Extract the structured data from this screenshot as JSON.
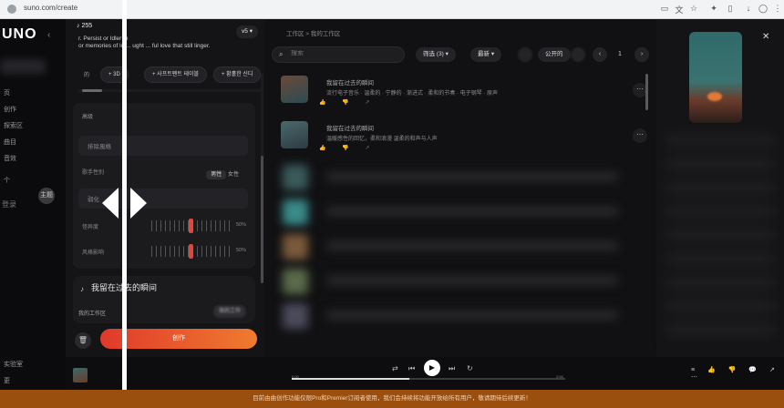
{
  "browser": {
    "url": "suno.com/create",
    "icons": [
      "tab-icon",
      "translate-icon",
      "star-icon",
      "extensions-icon",
      "sidebar-icon",
      "download-icon",
      "profile-icon",
      "menu-icon"
    ]
  },
  "sidebar": {
    "brand": "UNO",
    "collapse_icon": "‹",
    "items": [
      "页",
      "创作",
      "探索区",
      "曲目",
      "音效",
      "个",
      "计划"
    ],
    "bubble": "主题",
    "login": "登录",
    "bottom_items": [
      "实验室",
      "更"
    ]
  },
  "create": {
    "credits": "♪ 255",
    "model": "v5",
    "model_caret": "▾",
    "lyrics_lines": [
      "r. Persist or Idler fe",
      "or memories of lo ... ught ... ful love that still linger."
    ],
    "chips": [
      {
        "label": "+ 3D"
      },
      {
        "label": "+ 사프트펜트 테이블"
      },
      {
        "label": "+ 황홀한 신디"
      }
    ],
    "chip_prefix": "的",
    "section_label": "高级",
    "fields": [
      {
        "label": "排除風格"
      },
      {
        "label": "弱化"
      }
    ],
    "gender_label": "歌手性别",
    "gender_options": [
      "男性",
      "女性"
    ],
    "sliders": [
      {
        "label": "怪异度",
        "value": 0.45,
        "pct": "50%"
      },
      {
        "label": "风格影响",
        "value": 0.45,
        "pct": "50%"
      }
    ],
    "song_title": "我留在过去的瞬间",
    "song_title_icon": "♪",
    "workspace_label": "我的工作区",
    "workspace_chip": "我的工作",
    "create_label": "创作",
    "trash_icon": "🗑"
  },
  "workspace": {
    "breadcrumb": "工作区 > 我的工作区",
    "search_placeholder": "搜索",
    "search_icon": "⌕",
    "filter_label": "筛选 (3)",
    "sort_label": "最新",
    "filter_caret": "▾",
    "view_icons": [
      "grid-icon",
      "list-icon"
    ],
    "public_label": "公开的",
    "page": "1",
    "prev": "‹",
    "next": "›",
    "songs": [
      {
        "title": "我留在过去的瞬间",
        "tags": "流行电子音乐  · 温柔的  · 宁静的  · 渐进式  · 柔和的节奏 · 电子钢琴 · 原声",
        "actions": "👍 👎 ↗"
      },
      {
        "title": "我留在过去的瞬间",
        "tags": "温暖感性的回忆，柔和浪漫     温柔的和声与人声",
        "actions": "👍 👎 ↗"
      }
    ]
  },
  "preview": {
    "close_icon": "✕"
  },
  "player": {
    "shuffle": "⇄",
    "prev": "⏮",
    "play": "▶",
    "next": "⏭",
    "repeat": "↻",
    "progress": 0.43,
    "time_start": "0:00",
    "time_end": "2:54",
    "right_controls": "≡ 👍 👎 💬 ↗ ⋯"
  },
  "notice": {
    "text": "目前由曲创作功能仅限Pro和Premier订阅者使用，我们会持续将功能开放给所有用户，敬请期待后续更新！"
  }
}
